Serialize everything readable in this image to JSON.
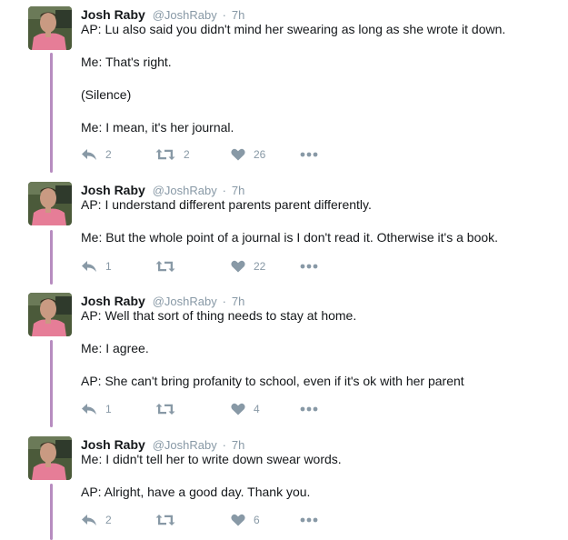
{
  "tweets": [
    {
      "name": "Josh Raby",
      "handle": "@JoshRaby",
      "sep": "·",
      "time": "7h",
      "lines": [
        "AP: Lu also said you didn't mind her swearing as long as she wrote it down.",
        "Me: That's right.",
        "(Silence)",
        "Me: I mean, it's her journal."
      ],
      "replies": "2",
      "retweets": "2",
      "likes": "26"
    },
    {
      "name": "Josh Raby",
      "handle": "@JoshRaby",
      "sep": "·",
      "time": "7h",
      "lines": [
        "AP: I understand different parents parent differently.",
        "Me: But the whole point of a journal is I don't read it. Otherwise it's a book."
      ],
      "replies": "1",
      "retweets": "",
      "likes": "22"
    },
    {
      "name": "Josh Raby",
      "handle": "@JoshRaby",
      "sep": "·",
      "time": "7h",
      "lines": [
        "AP: Well that sort of thing needs to stay at home.",
        "Me: I agree.",
        "AP: She can't bring profanity to school, even if it's ok with her parent"
      ],
      "replies": "1",
      "retweets": "",
      "likes": "4"
    },
    {
      "name": "Josh Raby",
      "handle": "@JoshRaby",
      "sep": "·",
      "time": "7h",
      "lines": [
        "Me: I didn't tell her to write down swear words.",
        "AP: Alright, have a good day. Thank you."
      ],
      "replies": "2",
      "retweets": "",
      "likes": "6"
    }
  ],
  "icons": {
    "reply": "reply-icon",
    "retweet": "retweet-icon",
    "like": "heart-icon",
    "more": "more-dots-icon"
  },
  "colors": {
    "thread_line": "#b78cc0",
    "muted": "#8899a6",
    "text": "#14171a"
  }
}
